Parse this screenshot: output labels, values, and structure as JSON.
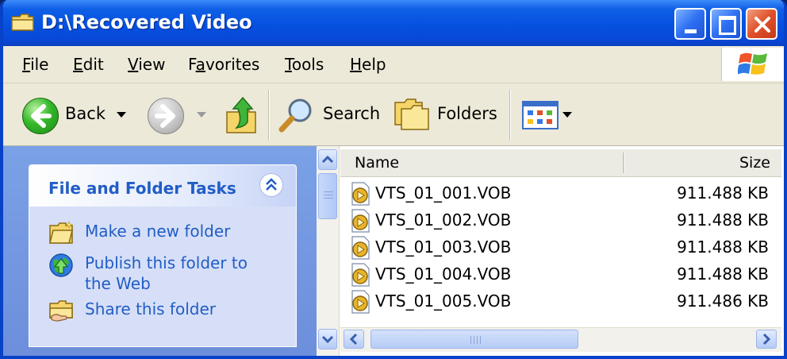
{
  "window": {
    "title": "D:\\Recovered Video",
    "title_icon": "folder-icon",
    "controls": [
      "minimize-icon",
      "maximize-icon",
      "close-icon"
    ]
  },
  "menubar": {
    "items": [
      {
        "label": "File",
        "underline": "F",
        "rest": "ile"
      },
      {
        "label": "Edit",
        "underline": "E",
        "rest": "dit"
      },
      {
        "label": "View",
        "underline": "V",
        "rest": "iew"
      },
      {
        "label": "Favorites",
        "pre": "F",
        "underline": "a",
        "rest": "vorites"
      },
      {
        "label": "Tools",
        "underline": "T",
        "rest": "ools"
      },
      {
        "label": "Help",
        "underline": "H",
        "rest": "elp"
      }
    ]
  },
  "toolbar": {
    "back_label": "Back",
    "search_label": "Search",
    "folders_label": "Folders"
  },
  "taskpane": {
    "title": "File and Folder Tasks",
    "items": [
      {
        "line1": "Make a new folder",
        "line2": ""
      },
      {
        "line1": "Publish this folder to",
        "line2": "the Web"
      },
      {
        "line1": "Share this folder",
        "line2": ""
      }
    ]
  },
  "fileview": {
    "columns": {
      "name": "Name",
      "size": "Size"
    },
    "files": [
      {
        "name": "VTS_01_001.VOB",
        "size": "911.488 KB"
      },
      {
        "name": "VTS_01_002.VOB",
        "size": "911.488 KB"
      },
      {
        "name": "VTS_01_003.VOB",
        "size": "911.488 KB"
      },
      {
        "name": "VTS_01_004.VOB",
        "size": "911.488 KB"
      },
      {
        "name": "VTS_01_005.VOB",
        "size": "911.486 KB"
      }
    ]
  },
  "colors": {
    "titlebar": "#0651e0",
    "task_link": "#215dc6",
    "taskpane_bg": "#7aa1e6"
  }
}
